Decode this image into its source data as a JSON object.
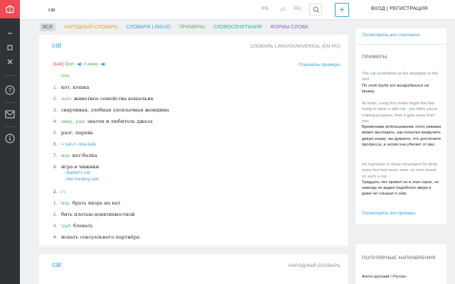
{
  "topbar": {
    "query": "cat",
    "lang_from": "EN",
    "lang_to": "RU",
    "auth": "ВХОД | РЕГИСТРАЦИЯ",
    "plus": "+"
  },
  "tabs": [
    {
      "label": "ВСЕ",
      "color": "#555555"
    },
    {
      "label": "НАРОДНЫЙ СЛОВАРЬ",
      "color": "#f0a030"
    },
    {
      "label": "СЛОВАРИ LINGVO",
      "color": "#3aa0dd"
    },
    {
      "label": "ПРИМЕРЫ",
      "color": "#57b55d"
    },
    {
      "label": "СЛОВОСОЧЕТАНИЯ",
      "color": "#27b5a0"
    },
    {
      "label": "ФОРМЫ СЛОВА",
      "color": "#a25ac8"
    }
  ],
  "card": {
    "word": "cat",
    "dict": "СЛОВАРЬ LINGVOUNIVERSAL (EN-RU)",
    "transcription": "[kæt]",
    "brit": "брит.",
    "amer": "амер.",
    "show_examples": "Показать примеры",
    "pos_noun": "сущ.",
    "pos_verb": "гл.",
    "defs": [
      {
        "num": "1.",
        "label": "",
        "text": "кот, кошка"
      },
      {
        "num": "2.",
        "label": "зоол.",
        "text": "животное семейства кошачьих"
      },
      {
        "num": "3.",
        "label": "",
        "text": "сварливая, злобная злоязычная женщина"
      },
      {
        "num": "4.",
        "label": "амер.; разг.",
        "text": "знаток и любитель джаза"
      },
      {
        "num": "5.",
        "label": "",
        "text": "разг. парень"
      },
      {
        "num": "6.",
        "label": "",
        "text": "= cat-o'-nine-tails"
      },
      {
        "num": "7.",
        "label": "мор.",
        "text": "кат-балка"
      },
      {
        "num": "8.",
        "label": "",
        "text": "игра в чижики"
      }
    ],
    "subs": [
      "- barber's cat",
      "- like herding cats"
    ],
    "verb_defs": [
      {
        "num": "1.",
        "label": "мор.",
        "text": "брать якорь на кат"
      },
      {
        "num": "2.",
        "label": "",
        "text": "бить плетью-девятихвосткой"
      },
      {
        "num": "3.",
        "label": "груб.",
        "text": "блевать"
      },
      {
        "num": "4.",
        "label": "",
        "text": "искать сексуального партнёра"
      }
    ]
  },
  "card2": {
    "word": "cat",
    "dict": "НАРОДНЫЙ СЛОВАРЬ"
  },
  "right": {
    "see_all_phrases": "Посмотреть все сочетания",
    "examples_title": "ПРИМЕРЫ",
    "examples": [
      {
        "en_before": "The ",
        "en_hl": "cat",
        "en_after": " scrambled up the drainpipe to the roof.",
        "ru": "По этой трубе кот вскарабкался на крышу."
      },
      {
        "en_before": "At times, using this mode might feel like trying to tame a wild ",
        "en_hl": "cat",
        "en_after": " - you think you're making progress, then it gets away from you.",
        "ru": "Временами использование этого режима может выглядеть, как попытка приручить дикую кошку: вы думаете, что достигаете прогресса, а затем она убегает от вас."
      },
      {
        "en_before": "He had been in these mountains for thirty years but had never seen, or even heard of, such a ",
        "en_hl": "cat",
        "en_after": ".",
        "ru": "Тридцать лет провел он в этих горах, но никогда не видел подобного зверя и даже не слышал о нем."
      }
    ],
    "see_all_examples": "Посмотреть все примеры",
    "popular_title": "ПОПУЛЯРНЫЕ НАПРАВЛЕНИЯ",
    "popular_first": "Англо-русский / Русско-"
  },
  "colors": {
    "accent": "#3aa0dd",
    "brand": "#ef4a55",
    "rail": "#2f3237",
    "green": "#57b55d"
  }
}
